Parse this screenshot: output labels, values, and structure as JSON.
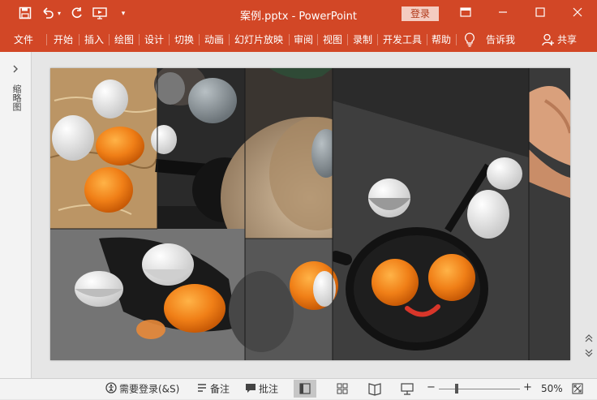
{
  "window": {
    "title": "案例.pptx  -  PowerPoint",
    "login_label": "登录"
  },
  "ribbon": {
    "tabs": [
      "文件",
      "开始",
      "插入",
      "绘图",
      "设计",
      "切换",
      "动画",
      "幻灯片放映",
      "审阅",
      "视图",
      "录制",
      "开发工具",
      "帮助"
    ],
    "tell_me": "告诉我",
    "share": "共享"
  },
  "left_pane": {
    "label": "缩略图"
  },
  "status_bar": {
    "login_required": "需要登录(&S)",
    "notes": "备注",
    "comments": "批注",
    "zoom_minus": "−",
    "zoom_plus": "+",
    "zoom_level": "50%",
    "zoom_fraction": 0.5
  },
  "colors": {
    "accent": "#d24726",
    "yolk": "#f07f17",
    "statusbar": "#f3f3f3"
  },
  "icons": [
    "save-icon",
    "undo-icon",
    "redo-icon",
    "present-icon",
    "customize-icon",
    "ribbon-display-icon",
    "minimize-icon",
    "maximize-icon",
    "close-icon",
    "lightbulb-icon",
    "share-icon",
    "chevron-right-icon",
    "scroll-up-icon",
    "scroll-down-icon",
    "accessibility-icon",
    "notes-icon",
    "comments-icon",
    "normal-view-icon",
    "sorter-view-icon",
    "reading-view-icon",
    "slideshow-view-icon",
    "fit-window-icon"
  ]
}
